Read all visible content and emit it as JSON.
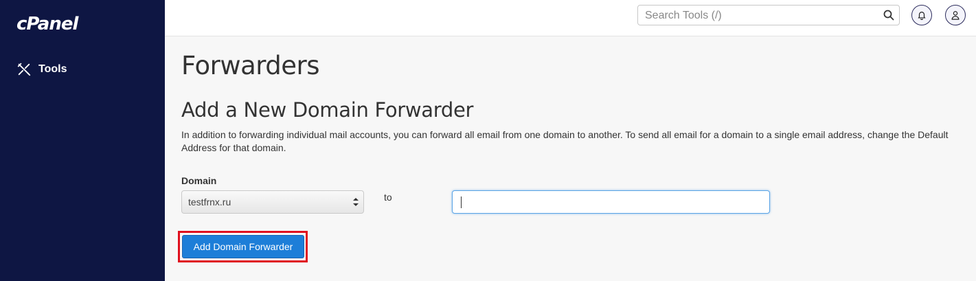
{
  "brand": {
    "logo_text": "cPanel"
  },
  "sidebar": {
    "items": [
      {
        "label": "Tools",
        "icon": "tools-icon"
      }
    ]
  },
  "header": {
    "search": {
      "placeholder": "Search Tools (/)",
      "value": ""
    },
    "icons": [
      "search-icon",
      "bell-icon",
      "user-icon"
    ]
  },
  "main": {
    "page_title": "Forwarders",
    "section_title": "Add a New Domain Forwarder",
    "description": "In addition to forwarding individual mail accounts, you can forward all email from one domain to another. To send all email for a domain to a single email address, change the Default Address for that domain.",
    "form": {
      "domain_label": "Domain",
      "domain_selected": "testfrnx.ru",
      "to_label": "to",
      "destination_value": "",
      "submit_label": "Add Domain Forwarder"
    }
  },
  "colors": {
    "sidebar_bg": "#0e1643",
    "primary_button": "#1d7ed8",
    "highlight_border": "#e0101e"
  }
}
